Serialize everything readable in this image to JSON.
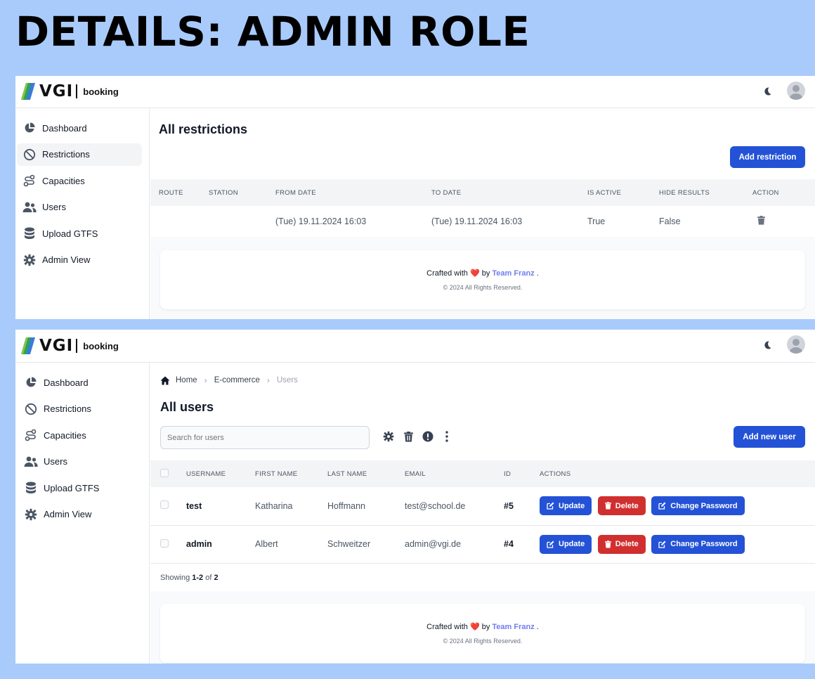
{
  "heading": "DETAILS: ADMIN ROLE",
  "brand": {
    "logo_text": "VGI",
    "app_name": "booking"
  },
  "sidebar": {
    "items": [
      {
        "label": "Dashboard",
        "icon": "pie-chart-icon"
      },
      {
        "label": "Restrictions",
        "icon": "ban-icon"
      },
      {
        "label": "Capacities",
        "icon": "route-icon"
      },
      {
        "label": "Users",
        "icon": "users-icon"
      },
      {
        "label": "Upload GTFS",
        "icon": "database-icon"
      },
      {
        "label": "Admin View",
        "icon": "gear-icon"
      }
    ]
  },
  "restrictions": {
    "title": "All restrictions",
    "add_button": "Add restriction",
    "columns": [
      "ROUTE",
      "STATION",
      "FROM DATE",
      "TO DATE",
      "IS ACTIVE",
      "HIDE RESULTS",
      "ACTION"
    ],
    "rows": [
      {
        "route": "",
        "station": "",
        "from_date": "(Tue) 19.11.2024 16:03",
        "to_date": "(Tue) 19.11.2024 16:03",
        "is_active": "True",
        "hide_results": "False"
      }
    ]
  },
  "users_page": {
    "breadcrumb": [
      "Home",
      "E-commerce",
      "Users"
    ],
    "title": "All users",
    "search_placeholder": "Search for users",
    "add_button": "Add new user",
    "columns": [
      "USERNAME",
      "FIRST NAME",
      "LAST NAME",
      "EMAIL",
      "ID",
      "ACTIONS"
    ],
    "rows": [
      {
        "username": "test",
        "first_name": "Katharina",
        "last_name": "Hoffmann",
        "email": "test@school.de",
        "id": "#5"
      },
      {
        "username": "admin",
        "first_name": "Albert",
        "last_name": "Schweitzer",
        "email": "admin@vgi.de",
        "id": "#4"
      }
    ],
    "actions": {
      "update": "Update",
      "delete": "Delete",
      "change_password": "Change Password"
    },
    "pagination": {
      "prefix": "Showing",
      "range": "1-2",
      "of": "of",
      "total": "2"
    }
  },
  "footer": {
    "crafted": "Crafted with",
    "by": "by",
    "team": "Team Franz",
    "period": ".",
    "copyright": "© 2024 All Rights Reserved."
  },
  "colors": {
    "primary": "#2452d6",
    "danger": "#d12f2f",
    "page_bg": "#a9cbfb",
    "team_link": "#6f7ef2"
  }
}
